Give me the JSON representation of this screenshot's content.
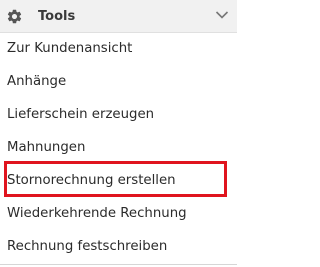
{
  "header": {
    "title": "Tools",
    "icon": "gear-icon",
    "toggle_icon": "chevron-down-icon"
  },
  "menu": {
    "items": [
      {
        "label": "Zur Kundenansicht"
      },
      {
        "label": "Anhänge"
      },
      {
        "label": "Lieferschein erzeugen"
      },
      {
        "label": "Mahnungen"
      },
      {
        "label": "Stornorechnung erstellen",
        "highlighted": true
      },
      {
        "label": "Wiederkehrende Rechnung"
      },
      {
        "label": "Rechnung festschreiben"
      }
    ]
  },
  "colors": {
    "header_bg": "#f1f1f1",
    "highlight": "#e0141e",
    "text": "#2b2b2b"
  }
}
